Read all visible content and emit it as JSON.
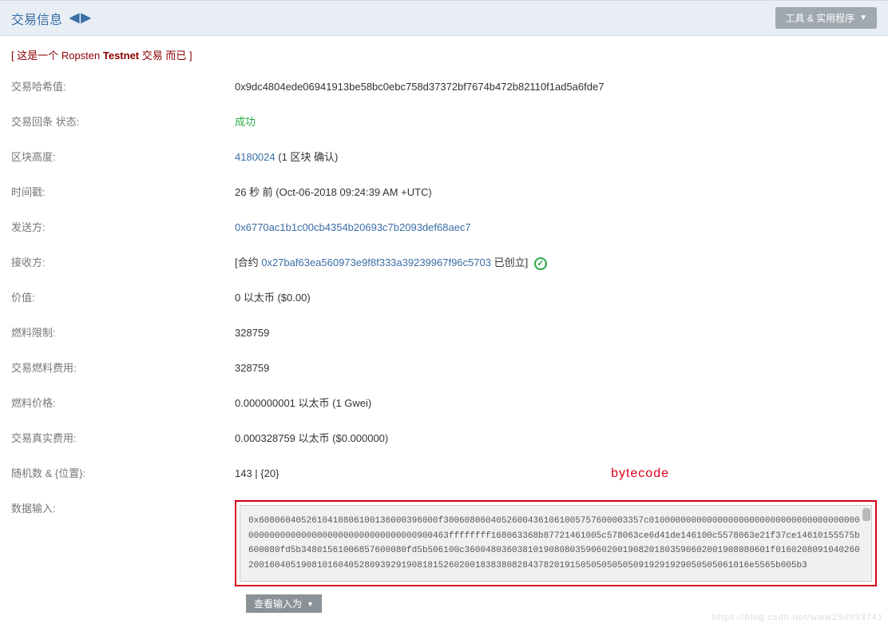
{
  "header": {
    "title": "交易信息",
    "tools_label": "工具 & 实用程序"
  },
  "notice": {
    "prefix": "[ 这是一个 Ropsten ",
    "bold": "Testnet",
    "suffix": " 交易 而已 ]"
  },
  "fields": {
    "tx_hash": {
      "label": "交易哈希值:",
      "value": "0x9dc4804ede06941913be58bc0ebc758d37372bf7674b472b82110f1ad5a6fde7"
    },
    "status": {
      "label": "交易回条 状态:",
      "value": "成功"
    },
    "block": {
      "label": "区块高度:",
      "link": "4180024",
      "suffix": " (1 区块 确认)"
    },
    "timestamp": {
      "label": "时间戳:",
      "value": "26 秒 前 (Oct-06-2018 09:24:39 AM +UTC)"
    },
    "from": {
      "label": "发送方:",
      "value": "0x6770ac1b1c00cb4354b20693c7b2093def68aec7"
    },
    "to": {
      "label": "接收方:",
      "prefix": "[合约 ",
      "link": "0x27baf63ea560973e9f8f333a39239967f96c5703",
      "suffix": " 已创立]"
    },
    "value": {
      "label": "价值:",
      "value": "0 以太币 ($0.00)"
    },
    "gas_limit": {
      "label": "燃料限制:",
      "value": "328759"
    },
    "gas_used": {
      "label": "交易燃料费用:",
      "value": "328759"
    },
    "gas_price": {
      "label": "燃料价格:",
      "value": "0.000000001 以太币 (1 Gwei)"
    },
    "actual_cost": {
      "label": "交易真实费用:",
      "value": "0.000328759 以太币 ($0.000000)"
    },
    "nonce": {
      "label": "随机数 & {位置}:",
      "value": "143 | {20}"
    },
    "input_data": {
      "label": "数据输入:",
      "value": "0x6080604052610410806100136000396000f30060806040526004361061005757600003357c010000000000000000000000000000000000000000000000000000000000000000000000900463ffffffff168063368b87721461005c578063ce6d41de146100c5578063e21f37ce14610155575b600080fd5b34801561006857600080fd5b506100c3600480360381019080803590602001908201803590602001908080601f016020809104026020016040519081016040528093929190818152602001838380828437820191505050505050919291929050505061016e5565b005b3"
    }
  },
  "annotation": "bytecode",
  "bottom": {
    "view_as_label": "查看输入为"
  },
  "watermark": "https://blog.csdn.net/www294993741"
}
